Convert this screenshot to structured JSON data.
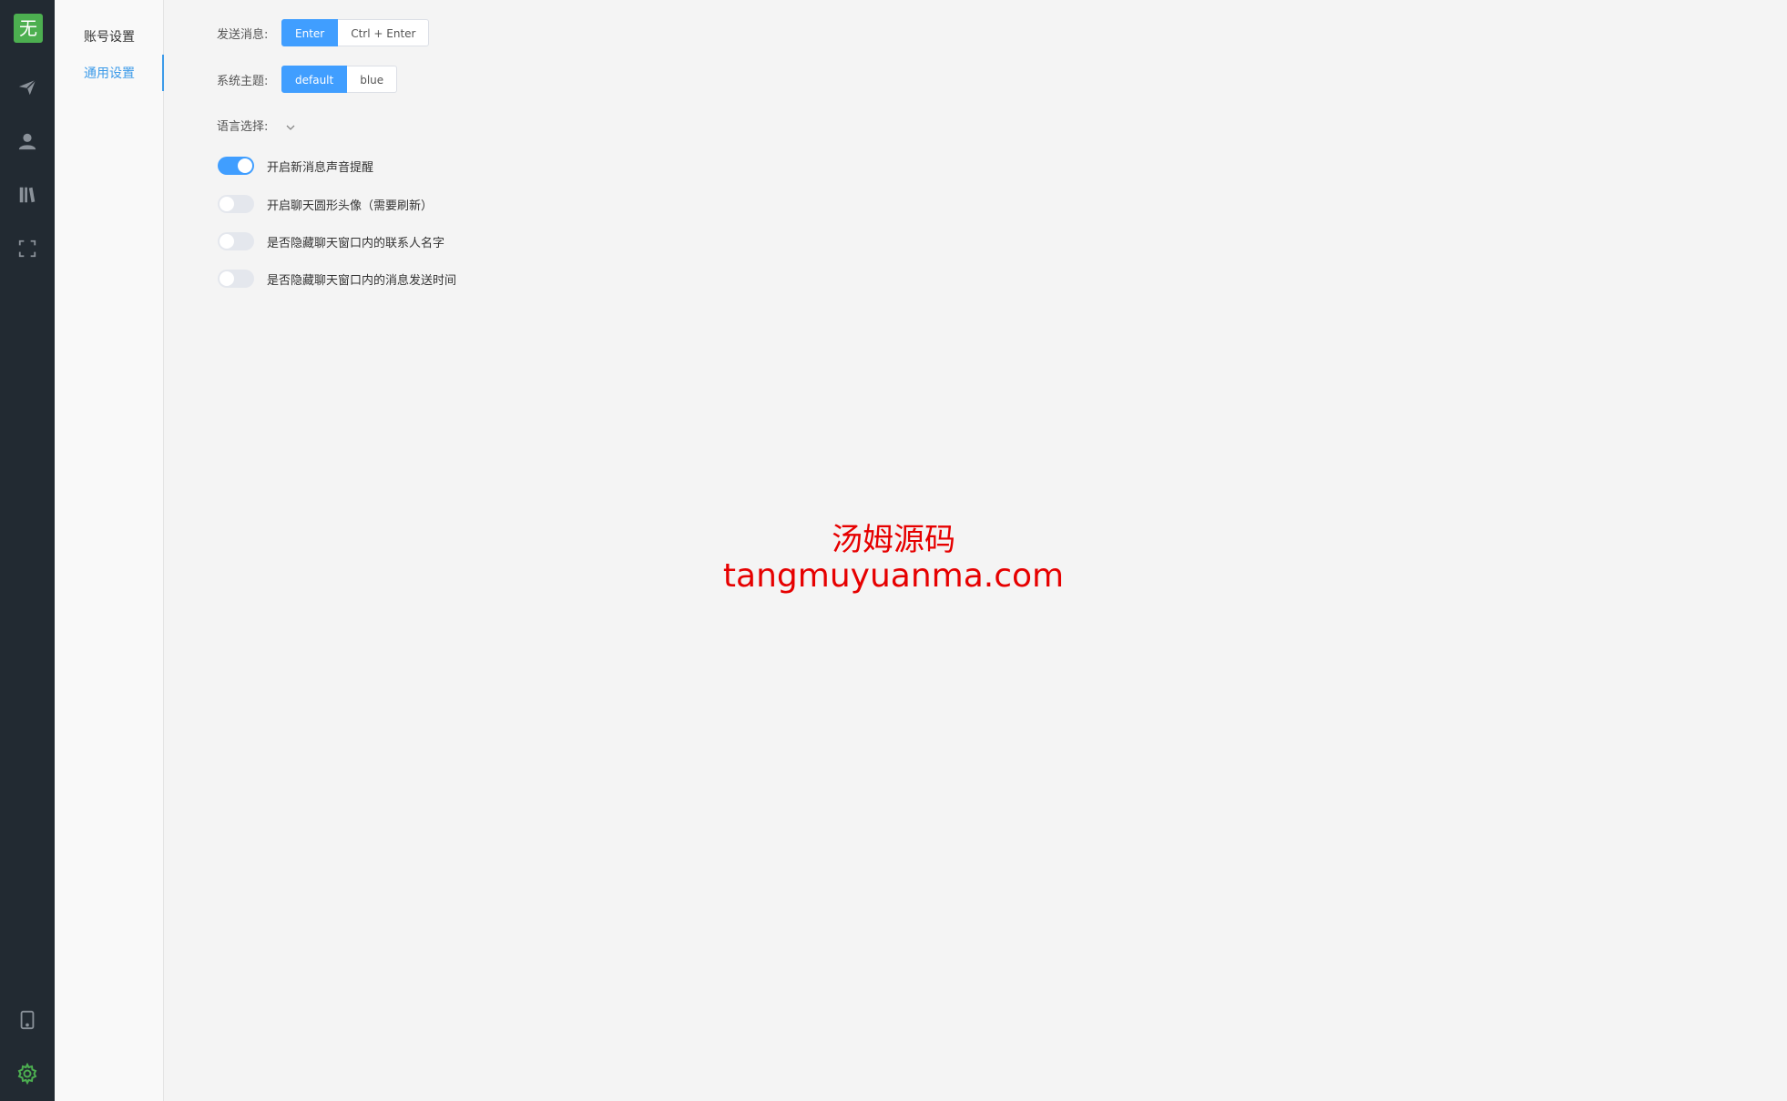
{
  "rail": {
    "logo_text": "无",
    "icons": [
      "paper-plane-icon",
      "user-icon",
      "books-icon",
      "fullscreen-icon",
      "tablet-icon",
      "gear-icon"
    ],
    "accent": "#4caf50"
  },
  "subnav": {
    "items": [
      {
        "label": "账号设置",
        "active": false
      },
      {
        "label": "通用设置",
        "active": true
      }
    ],
    "accent": "#3d9be9"
  },
  "settings": {
    "send_message": {
      "label": "发送消息:",
      "options": [
        "Enter",
        "Ctrl + Enter"
      ],
      "selected": "Enter"
    },
    "theme": {
      "label": "系统主题:",
      "options": [
        "default",
        "blue"
      ],
      "selected": "default"
    },
    "language": {
      "label": "语言选择:",
      "value": ""
    },
    "toggles": [
      {
        "label": "开启新消息声音提醒",
        "on": true
      },
      {
        "label": "开启聊天圆形头像（需要刷新）",
        "on": false
      },
      {
        "label": "是否隐藏聊天窗口内的联系人名字",
        "on": false
      },
      {
        "label": "是否隐藏聊天窗口内的消息发送时间",
        "on": false
      }
    ],
    "primary_color": "#409eff"
  },
  "watermark": {
    "line1": "汤姆源码",
    "line2": "tangmuyuanma.com",
    "color": "#e60000"
  }
}
